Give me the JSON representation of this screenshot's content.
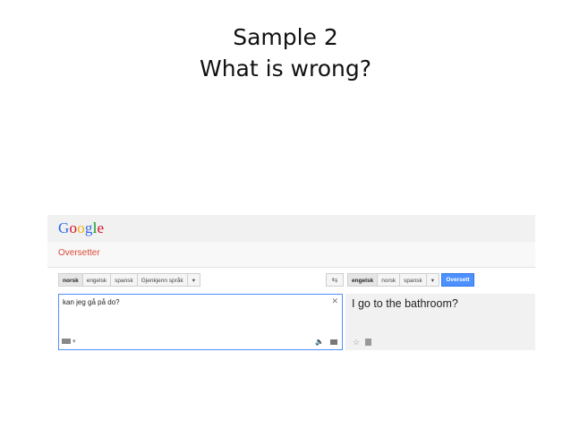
{
  "slide": {
    "title_line1": "Sample 2",
    "title_line2": "What is wrong?"
  },
  "app": {
    "logo_letters": [
      "G",
      "o",
      "o",
      "g",
      "l",
      "e"
    ],
    "logo_colors": [
      "#3369e8",
      "#d50f25",
      "#eeb211",
      "#3369e8",
      "#009925",
      "#d50f25"
    ],
    "subtitle": "Oversetter"
  },
  "source": {
    "languages": [
      "norsk",
      "engelsk",
      "spansk",
      "Gjenkjenn språk"
    ],
    "selected": "norsk",
    "dropdown_glyph": "▾",
    "text": "kan jeg gå på do?",
    "clear_glyph": "✕"
  },
  "target": {
    "languages": [
      "engelsk",
      "norsk",
      "spansk"
    ],
    "selected": "engelsk",
    "dropdown_glyph": "▾",
    "translate_label": "Oversett",
    "text": "I go to the bathroom?"
  },
  "icons": {
    "swap": "swap-languages-icon",
    "keyboard": "keyboard-icon",
    "listen": "speaker-icon",
    "comment": "comment-icon",
    "star": "star-icon",
    "document": "document-icon"
  },
  "colors": {
    "accent_blue": "#4d90fe",
    "subtitle_red": "#dd4b39"
  }
}
